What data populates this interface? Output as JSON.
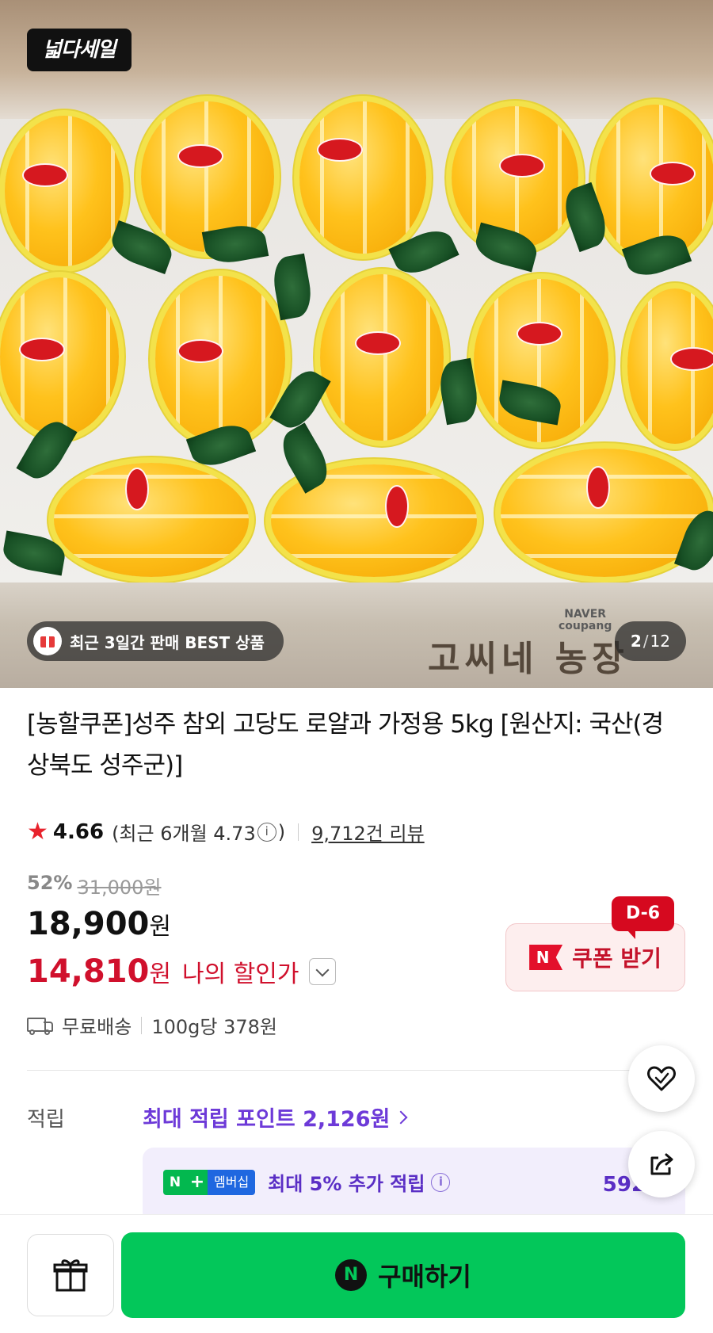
{
  "hero": {
    "brand_badge": "넓다세일",
    "best_label": "최근 3일간 판매 BEST 상품",
    "page_current": "2",
    "page_sep": "/",
    "page_total": "12",
    "box_text": "고씨네 농장",
    "box_brand": "NAVER\ncoupang"
  },
  "product": {
    "title": "[농할쿠폰]성주 참외 고당도 로얄과 가정용 5kg [원산지: 국산(경상북도 성주군)]",
    "rating": "4.66",
    "recent_rating_prefix": "(최근 6개월 4.73",
    "recent_rating_suffix": ")",
    "review_count": "9,712건 리뷰",
    "discount_rate": "52%",
    "original_price": "31,000원",
    "price_amount": "18,900",
    "price_unit": "원",
    "my_price_amount": "14,810",
    "my_price_unit": "원",
    "my_price_label": "나의 할인가",
    "coupon_label": "쿠폰 받기",
    "coupon_badge": "N",
    "coupon_dday": "D-6",
    "shipping": "무료배송",
    "unit_price": "100g당 378원"
  },
  "points": {
    "label": "적립",
    "max_points": "최대 적립 포인트 2,126원",
    "member_badge_n": "N",
    "member_badge_plus": "+",
    "member_badge_text": "멤버십",
    "member_text": "최대 5% 추가 적립",
    "member_amount": "592원"
  },
  "bottom": {
    "buy_label": "구매하기",
    "buy_icon_text": "N"
  },
  "colors": {
    "accent_green": "#03c75a",
    "price_red": "#d0102c",
    "points_purple": "#6d3ad8"
  }
}
